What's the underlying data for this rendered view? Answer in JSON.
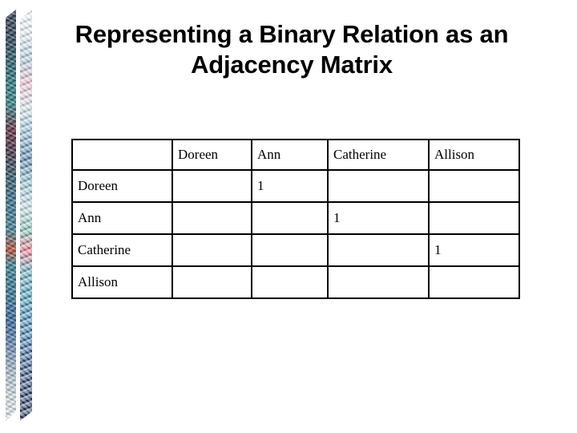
{
  "slide": {
    "title_line1": "Representing a Binary Relation as an",
    "title_line2": "Adjacency Matrix",
    "title_full": "Representing a Binary Relation as an Adjacency Matrix",
    "background_color": "#ffffff",
    "text_color": "#000000"
  },
  "decoration": {
    "name": "left-edge-mosaic-ribbon",
    "band_left_colors": [
      "#2b3550",
      "#1f6f77",
      "#5c2437",
      "#2f6f8b",
      "#b8462f",
      "#2b5f98",
      "#eef4f8"
    ],
    "band_right_colors": [
      "#f4f8fb",
      "#9fc4d8",
      "#e8b9c6",
      "#3c6f9e",
      "#e4647a",
      "#2f88a8",
      "#0e1f45"
    ]
  },
  "matrix": {
    "border_color": "#000000",
    "corner_label": "",
    "columns": [
      "",
      "Doreen",
      "Ann",
      "Catherine",
      "Allison"
    ],
    "row_labels": [
      "Doreen",
      "Ann",
      "Catherine",
      "Allison"
    ],
    "rows": [
      {
        "label": "Doreen",
        "cells": [
          "",
          "1",
          "",
          ""
        ]
      },
      {
        "label": "Ann",
        "cells": [
          "",
          "",
          "1",
          ""
        ]
      },
      {
        "label": "Catherine",
        "cells": [
          "",
          "",
          "",
          "1"
        ]
      },
      {
        "label": "Allison",
        "cells": [
          "",
          "",
          "",
          ""
        ]
      }
    ]
  }
}
